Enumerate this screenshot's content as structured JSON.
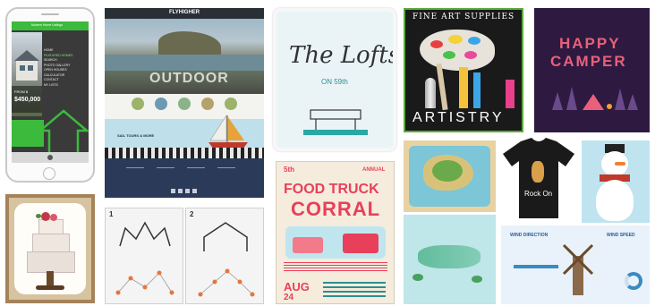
{
  "phone": {
    "sidebar_title": "Modern Home Listings",
    "menu_items": [
      "HOME",
      "FEATURED HOMES",
      "SEARCH",
      "PHOTO GALLERY",
      "OPEN HOUSES",
      "CALCULATOR",
      "CONTACT",
      "MY LISTS"
    ],
    "price_label": "FROM $",
    "price": "$450,000"
  },
  "web": {
    "logo": "FLYHIGHER",
    "hero_text": "OUTDOOR",
    "section_label": "SAIL TOURS & MORE"
  },
  "lofts": {
    "title": "The Lofts",
    "subtitle": "ON 59th"
  },
  "artistry": {
    "top_text": "FINE ART SUPPLIES",
    "bottom_text": "ARTISTRY"
  },
  "camper": {
    "line1": "HAPPY",
    "line2": "CAMPER"
  },
  "food_truck": {
    "top_left": "5th",
    "top_right": "ANNUAL",
    "title": "FOOD TRUCK",
    "subtitle": "CORRAL",
    "date_month": "AUG",
    "date_day": "24"
  },
  "tshirt": {
    "text": "Rock On"
  },
  "wireframe": {
    "panel1_number": "1",
    "panel2_number": "2"
  },
  "weather": {
    "label1": "WIND DIRECTION",
    "label2": "WIND SPEED"
  },
  "colors": {
    "green": "#3cba3c",
    "navy": "#243a5e",
    "teal": "#2c8f8f",
    "pink": "#e8405a",
    "purple_dark": "#2e1a40"
  }
}
